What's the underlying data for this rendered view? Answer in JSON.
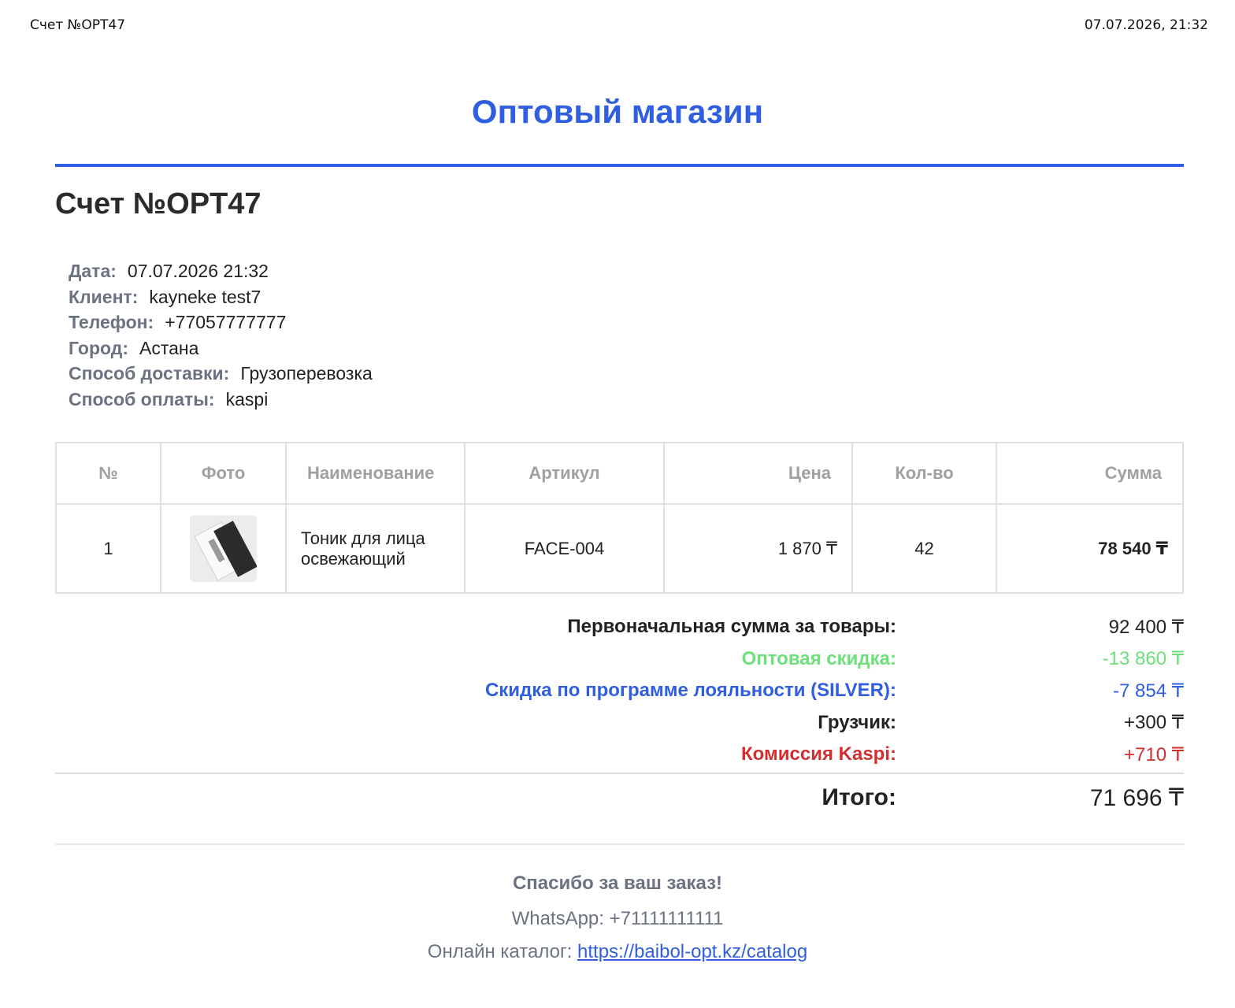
{
  "print_header": {
    "left": "Счет №OPT47",
    "right": "07.07.2026, 21:32"
  },
  "shop_title": "Оптовый магазин",
  "invoice_title": "Счет №OPT47",
  "info": [
    {
      "key": "Дата:",
      "value": "07.07.2026 21:32"
    },
    {
      "key": "Клиент:",
      "value": "kayneke test7"
    },
    {
      "key": "Телефон:",
      "value": "+77057777777"
    },
    {
      "key": "Город:",
      "value": "Астана"
    },
    {
      "key": "Способ доставки:",
      "value": "Грузоперевозка"
    },
    {
      "key": "Способ оплаты:",
      "value": "kaspi"
    }
  ],
  "table": {
    "headers": [
      "№",
      "Фото",
      "Наименование",
      "Артикул",
      "Цена",
      "Кол-во",
      "Сумма"
    ],
    "rows": [
      {
        "num": "1",
        "photo_icon": "product-photo",
        "name": "Тоник для лица освежающий",
        "sku": "FACE-004",
        "price": "1 870 ₸",
        "qty": "42",
        "sum": "78 540 ₸"
      }
    ]
  },
  "totals": [
    {
      "label": "Первоначальная сумма за товары:",
      "value": "92 400 ₸",
      "color": "#222222"
    },
    {
      "label": "Оптовая скидка:",
      "value": "-13 860 ₸",
      "color": "#6ee07a"
    },
    {
      "label": "Скидка по программе лояльности (SILVER):",
      "value": "-7 854 ₸",
      "color": "#2f5fe0"
    },
    {
      "label": "Грузчик:",
      "value": "+300 ₸",
      "color": "#222222"
    },
    {
      "label": "Комиссия Kaspi:",
      "value": "+710 ₸",
      "color": "#d12f2f"
    }
  ],
  "grand_total": {
    "label": "Итого:",
    "value": "71 696 ₸"
  },
  "footer": {
    "thanks": "Спасибо за ваш заказ!",
    "whatsapp": "WhatsApp: +71111111111",
    "catalog_label": "Онлайн каталог:",
    "catalog_link": "https://baibol-opt.kz/catalog"
  },
  "colors": {
    "accent": "#2f5fe0",
    "green": "#6ee07a",
    "red": "#d12f2f"
  }
}
